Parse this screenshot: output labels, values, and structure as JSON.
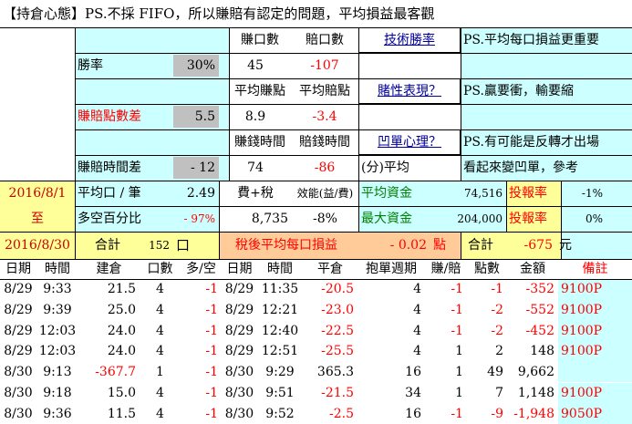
{
  "title": "【持倉心態】PS.不採 FIFO，所以賺賠有認定的問題，平均損益最客觀",
  "stats": {
    "win_label": "勝率",
    "win_value": "30%",
    "diff_label": "賺賠點數差",
    "diff_value": "5.5",
    "timediff_label": "賺賠時間差",
    "timediff_value": "-   12",
    "wins_label": "賺口數",
    "wins_value": "45",
    "losses_label": "賠口數",
    "losses_value": "-107",
    "avgwin_label": "平均賺點",
    "avgwin_value": "8.9",
    "avgloss_label": "平均賠點",
    "avgloss_value": "-3.4",
    "wintime_label": "賺錢時間",
    "wintime_value": "74",
    "losstime_label": "賠錢時間",
    "losstime_value": "-86",
    "unit_label": "(分)平均",
    "btn_tech": "技術勝率",
    "btn_gamble": "賭性表現？",
    "btn_avgdown": "凹單心理？",
    "note1": "PS.平均每口損益更重要",
    "note2": "PS.贏要衝，輸要縮",
    "note3": "PS.有可能是反轉才出場",
    "note4": "看起來變凹單，參考"
  },
  "summary": {
    "date_start": "2016/8/1",
    "to": "至",
    "date_end": "2016/8/30",
    "avg_label": "平均口 / 筆",
    "avg_value": "2.49",
    "longshort_label": "多空百分比",
    "longshort_value": "- 97%",
    "total_label": "合計",
    "total_value": "152",
    "total_unit": "口",
    "fee_label": "費+稅",
    "fee_value": "8,735",
    "eff_label": "效能(益/費)",
    "eff_value": "-8%",
    "avgfund_label": "平均資金",
    "avgfund_value": "74,516",
    "maxfund_label": "最大資金",
    "maxfund_value": "204,000",
    "roi_label": "投報率",
    "roi_value": "-1%",
    "roi2_label": "投報率",
    "roi2_value": "0%",
    "aftertax_label": "稅後平均每口損益",
    "aftertax_value": "-      0.02",
    "aftertax_unit": "點",
    "sum_label": "合計",
    "sum_value": "-675",
    "sum_unit": "元"
  },
  "table": {
    "headers": [
      "日期",
      "時間",
      "建倉",
      "口數",
      "多/空",
      "日期",
      "時間",
      "平倉",
      "抱單週期",
      "賺/賠",
      "點數",
      "金額",
      "備註"
    ],
    "rows": [
      [
        "8/29",
        "9:33",
        "21.5",
        "4",
        "-1",
        "8/29",
        "11:35",
        "-20.5",
        "4",
        "-1",
        "-1",
        "-352",
        "9100P"
      ],
      [
        "8/29",
        "9:39",
        "25.0",
        "4",
        "-1",
        "8/29",
        "12:21",
        "-23.0",
        "4",
        "-1",
        "-2",
        "-552",
        "9100P"
      ],
      [
        "8/29",
        "12:03",
        "24.0",
        "4",
        "-1",
        "8/29",
        "12:40",
        "-22.5",
        "4",
        "-1",
        "-2",
        "-452",
        "9100P"
      ],
      [
        "8/29",
        "12:03",
        "24.0",
        "4",
        "-1",
        "8/29",
        "12:51",
        "-25.5",
        "4",
        "1",
        "2",
        "148",
        "9100P"
      ],
      [
        "8/30",
        "9:13",
        "-367.7",
        "1",
        "-1",
        "8/30",
        "9:29",
        "365.3",
        "16",
        "1",
        "49",
        "9,662",
        ""
      ],
      [
        "8/30",
        "9:18",
        "15.0",
        "4",
        "-1",
        "8/30",
        "9:51",
        "-21.5",
        "34",
        "1",
        "7",
        "1,148",
        "9100P"
      ],
      [
        "8/30",
        "9:36",
        "11.5",
        "4",
        "-1",
        "8/30",
        "9:52",
        "-2.5",
        "16",
        "-1",
        "-9",
        "-1,948",
        "9050P"
      ]
    ]
  },
  "colors": {
    "cyan": "#ccffff",
    "gray": "#c0c0c0",
    "yellow": "#ffff99",
    "orange": "#ffcc99",
    "red": "#ff0000"
  }
}
